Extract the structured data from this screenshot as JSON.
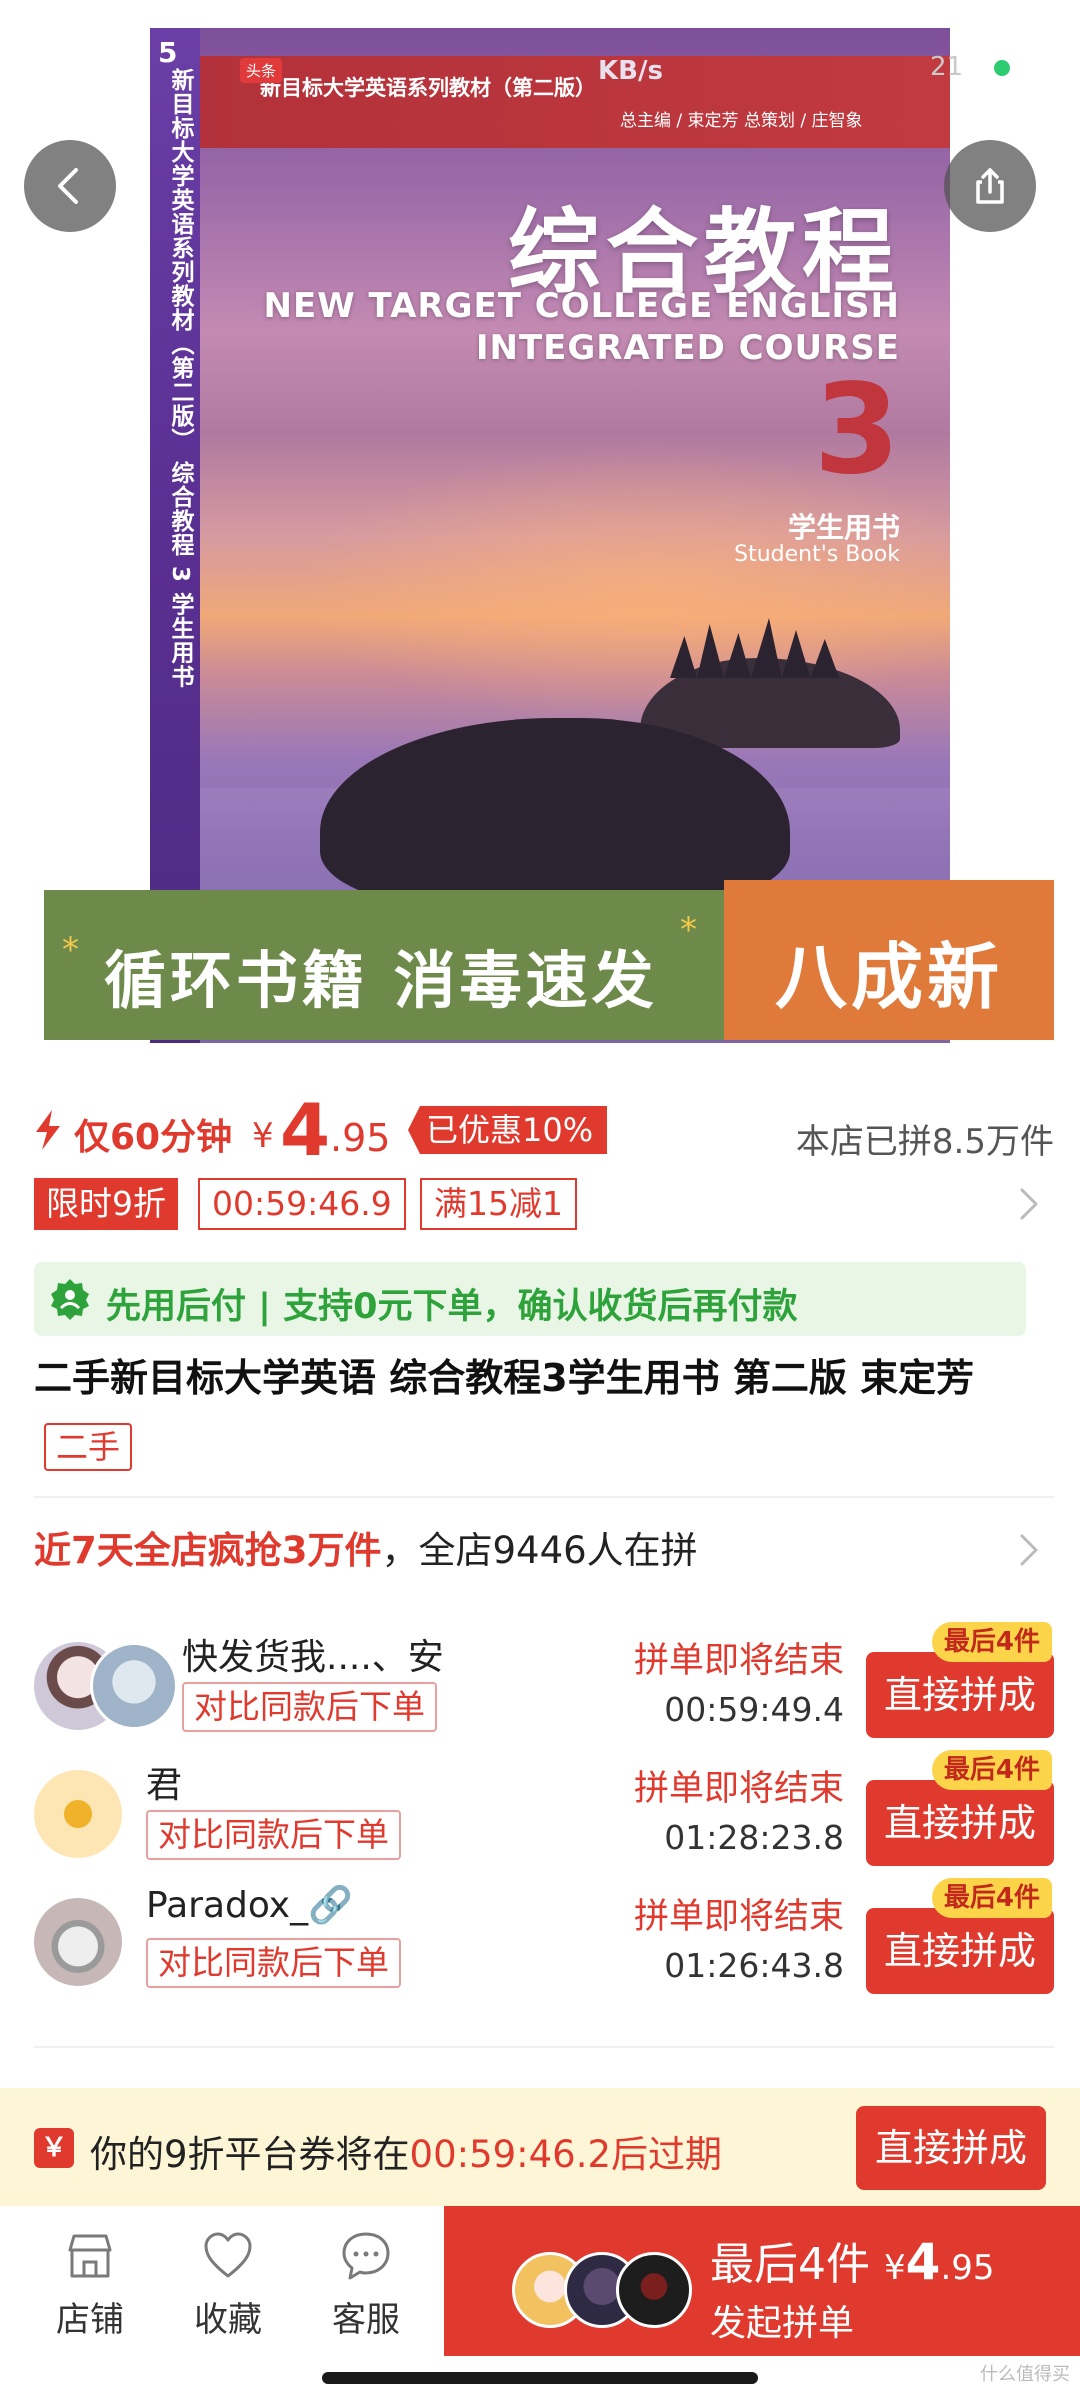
{
  "cover": {
    "tag": "头条",
    "spine_number": "5",
    "spine_text": "新目标大学英语系列教材（第二版） 综合教程 3 学生用书",
    "series": "新目标大学英语系列教材（第二版）",
    "editors": "总主编 / 束定芳  总策划 / 庄智象",
    "title_cn": "综合教程",
    "title_en_line1": "NEW TARGET COLLEGE ENGLISH",
    "title_en_line2": "INTEGRATED COURSE",
    "volume": "3",
    "student_cn": "学生用书",
    "student_en": "Student's Book",
    "banner_slogan": "循环书籍  消毒速发",
    "banner_condition": "八成新"
  },
  "status": {
    "speed": "KB/s",
    "battery": "21"
  },
  "price": {
    "flash_label": "仅60分钟",
    "currency": "¥",
    "integer": "4",
    "decimal": ".95",
    "discount": "已优惠10%",
    "sold": "本店已拼8.5万件"
  },
  "promo": {
    "limited": "限时9折",
    "timer": "00:59:46.9",
    "coupon": "满15减1"
  },
  "paylater": {
    "text": "先用后付 | 支持0元下单，确认收货后再付款"
  },
  "product": {
    "title": "二手新目标大学英语 综合教程3学生用书 第二版 束定芳",
    "tag": "二手"
  },
  "hot": {
    "hot_text": "近7天全店疯抢3万件",
    "rest_text": "，全店9446人在拼"
  },
  "groups": [
    {
      "name": "快发货我....、安",
      "compare": "对比同款后下单",
      "ending": "拼单即将结束",
      "timer": "00:59:49.4",
      "button": "直接拼成",
      "badge": "最后4件"
    },
    {
      "name": "君",
      "compare": "对比同款后下单",
      "ending": "拼单即将结束",
      "timer": "01:28:23.8",
      "button": "直接拼成",
      "badge": "最后4件"
    },
    {
      "name": "Paradox_🔗",
      "compare": "对比同款后下单",
      "ending": "拼单即将结束",
      "timer": "01:26:43.8",
      "button": "直接拼成",
      "badge": "最后4件"
    }
  ],
  "coupon_bar": {
    "icon": "￥",
    "prefix": "你的9折平台券将在",
    "timer": "00:59:46.2后过期",
    "button": "直接拼成"
  },
  "bottom": {
    "tabs": [
      {
        "label": "店铺",
        "icon": "store-icon"
      },
      {
        "label": "收藏",
        "icon": "heart-icon"
      },
      {
        "label": "客服",
        "icon": "chat-icon"
      }
    ],
    "buy_line1_prefix": "最后4件",
    "buy_currency": "¥",
    "buy_integer": "4",
    "buy_decimal": ".95",
    "buy_line2": "发起拼单"
  },
  "watermark": "什么值得买",
  "colors": {
    "accent_red": "#e03a2e",
    "green": "#2fa33b",
    "badge_yellow": "#fbd44a"
  }
}
